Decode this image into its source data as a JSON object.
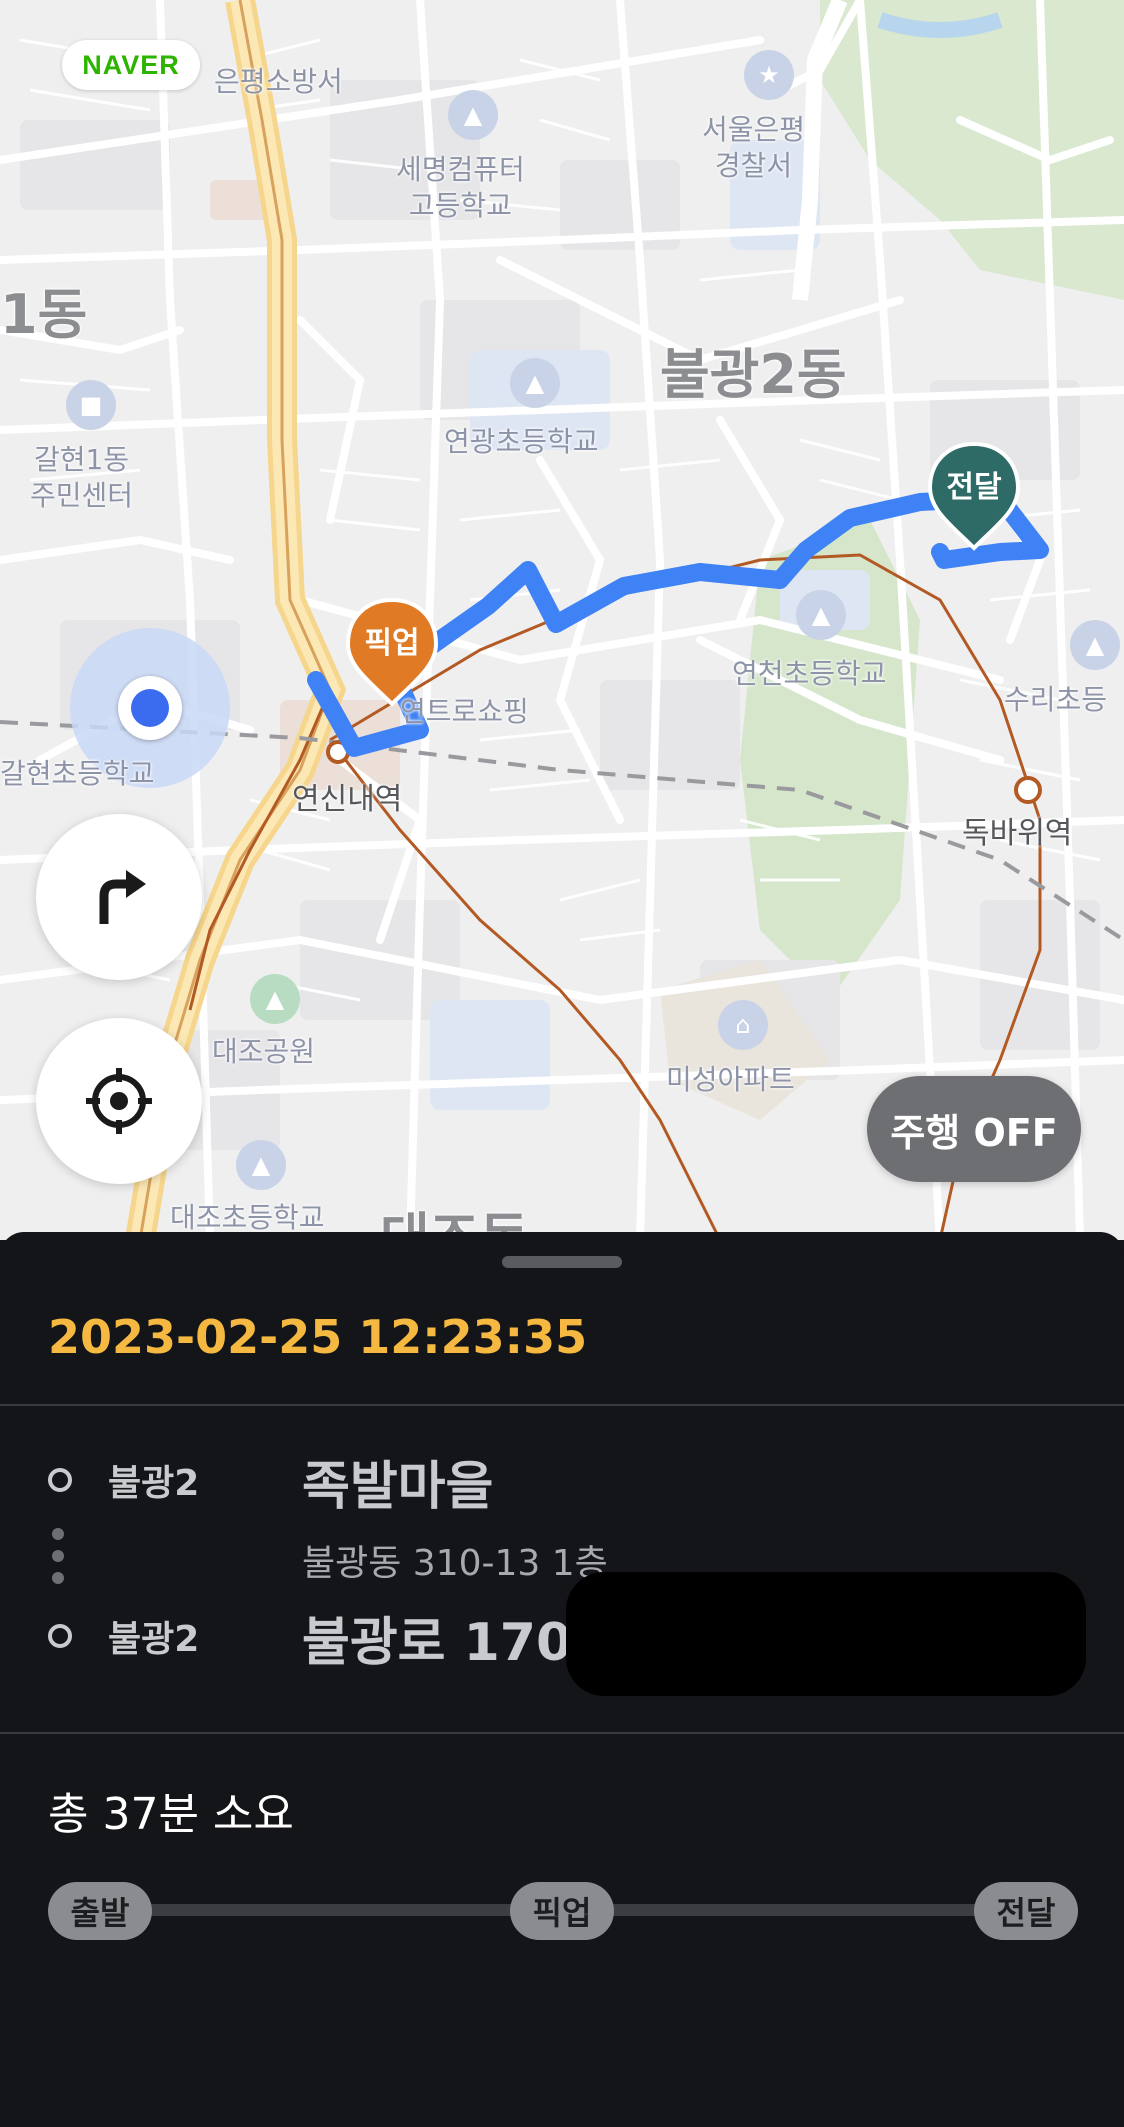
{
  "map": {
    "brand": "NAVER",
    "labels": {
      "fire_station": "은평소방서",
      "police_station": "서울은평\n경찰서",
      "school_semyeong": "세명컴퓨터\n고등학교",
      "dong_1": "1동",
      "dong_bulgwang2": "불광2동",
      "community_center": "갈현1동\n주민센터",
      "school_yeongwang": "연광초등학교",
      "school_yeoncheon": "연천초등학교",
      "shopping": "연트로쇼핑",
      "school_galhyeon": "갈현초등학교",
      "station_yeonsinnae": "연신내역",
      "station_dokbawi": "독바위역",
      "school_suri": "수리초등",
      "park_daejo": "대조공원",
      "apt_miseong": "미성아파트",
      "school_daejo": "대조초등학교",
      "dong_daejo": "대조동"
    },
    "pickup_marker": "픽업",
    "delivery_marker": "전달",
    "drive_toggle": "주행 OFF",
    "buttons": {
      "navigate_icon": "turn-right-arrow-icon",
      "locate_icon": "crosshair-icon"
    },
    "colors": {
      "route": "#3f82f5",
      "pickup": "#e07a25",
      "delivery": "#2e6a66",
      "location": "#3b6cf0"
    }
  },
  "sheet": {
    "timestamp": "2023-02-25 12:23:35",
    "pickup": {
      "area": "불광2",
      "name": "족발마을",
      "address": "불광동 310-13 1층"
    },
    "dropoff": {
      "area": "불광2",
      "name": "불광로 170"
    },
    "total_time": "총 37분 소요",
    "progress_steps": [
      "출발",
      "픽업",
      "전달"
    ],
    "colors": {
      "timestamp": "#f5b942",
      "background": "#141518"
    }
  }
}
